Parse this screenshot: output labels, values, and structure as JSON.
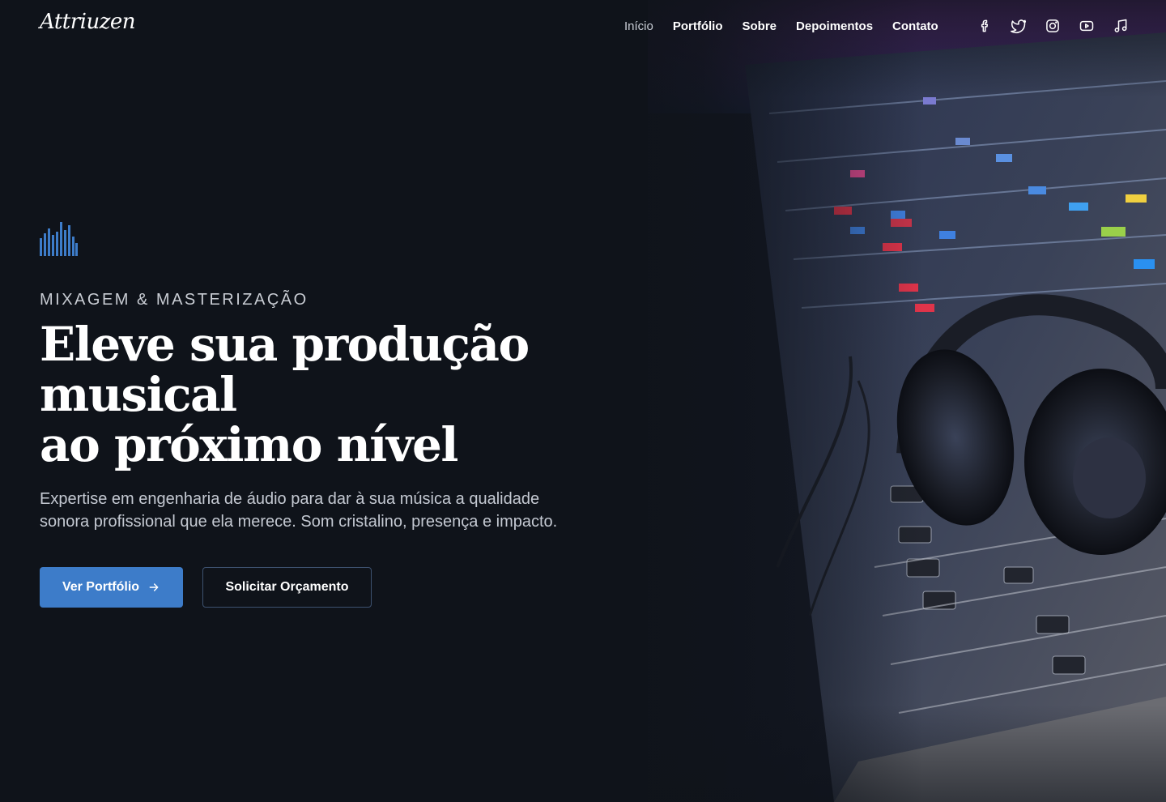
{
  "header": {
    "logo": "Attriuzen",
    "nav": [
      {
        "label": "Início",
        "active": true
      },
      {
        "label": "Portfólio",
        "active": false
      },
      {
        "label": "Sobre",
        "active": false
      },
      {
        "label": "Depoimentos",
        "active": false
      },
      {
        "label": "Contato",
        "active": false
      }
    ],
    "socials": [
      "facebook-icon",
      "twitter-icon",
      "instagram-icon",
      "youtube-icon",
      "music-note-icon"
    ]
  },
  "hero": {
    "eyebrow": "MIXAGEM & MASTERIZAÇÃO",
    "headline_line1": "Eleve sua produção musical",
    "headline_line2": "ao próximo nível",
    "subtitle": "Expertise em engenharia de áudio para dar à sua música a qualidade sonora profissional que ela merece. Som cristalino, presença e impacto.",
    "primary_cta": "Ver Portfólio",
    "secondary_cta": "Solicitar Orçamento"
  },
  "colors": {
    "background": "#0f131a",
    "accent": "#3d7cc9",
    "text": "#ffffff",
    "muted_text": "#c4c9d2"
  }
}
